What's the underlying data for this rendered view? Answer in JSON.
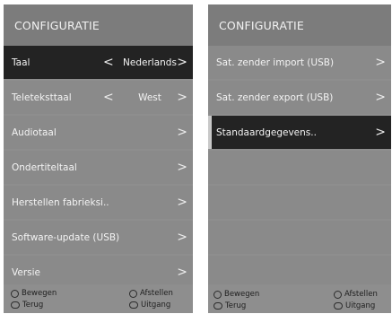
{
  "left_panel": {
    "title": "CONFIGURATIE",
    "rows": [
      {
        "label": "Taal",
        "value": "Nederlands"
      },
      {
        "label": "Teletekst­taal",
        "value": "West"
      },
      {
        "label": "Audiotaal"
      },
      {
        "label": "Ondertiteltaal"
      },
      {
        "label": "Herstellen fabrieksi.."
      },
      {
        "label": "Software-update (USB)"
      },
      {
        "label": "Versie"
      }
    ],
    "footer": {
      "move": "Bewegen",
      "back": "Terug",
      "adjust": "Afstellen",
      "exit": "Uitgang"
    }
  },
  "right_panel": {
    "title": "CONFIGURATIE",
    "rows": [
      {
        "label": "Sat. zender import (USB)"
      },
      {
        "label": "Sat. zender export (USB)"
      },
      {
        "label": "Standaardgegevens.."
      }
    ],
    "footer": {
      "move": "Bewegen",
      "back": "Terug",
      "adjust": "Afstellen",
      "exit": "Uitgang"
    }
  },
  "arrows": {
    "left": "<",
    "right": ">"
  }
}
